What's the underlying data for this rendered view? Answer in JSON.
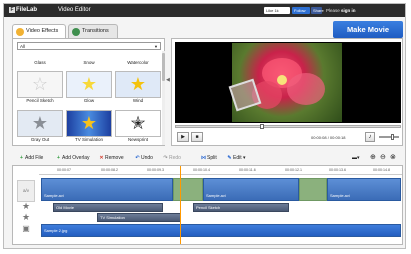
{
  "header": {
    "logo": "FileLab",
    "app_title": "Video Editor",
    "social": [
      "Like 1k",
      "Follow",
      "Share"
    ],
    "login_prefix": "Please",
    "login_link": "sign in"
  },
  "tabs": [
    {
      "label": "Video Effects"
    },
    {
      "label": "Transitions"
    }
  ],
  "make_movie_label": "Make Movie",
  "effects": {
    "filter_selected": "All",
    "items": [
      {
        "label": "Glass"
      },
      {
        "label": "Snow"
      },
      {
        "label": "Watercolor"
      },
      {
        "label": "Pencil Sketch"
      },
      {
        "label": "Glow"
      },
      {
        "label": "Wind"
      },
      {
        "label": "Gray Out"
      },
      {
        "label": "TV Simulation"
      },
      {
        "label": "Newsprint"
      }
    ]
  },
  "player": {
    "time_current": "00:00:08",
    "time_total": "00:00:18",
    "progress": 0.38,
    "volume": 0.7
  },
  "toolbar": {
    "add_file": "Add File",
    "add_overlay": "Add Overlay",
    "remove": "Remove",
    "undo": "Undo",
    "redo": "Redo",
    "split": "Split",
    "edit": "Edit"
  },
  "timeline": {
    "ruler": [
      "00:00:07",
      "00:00:08.2",
      "00:00:09.3",
      "00:00:10.4",
      "00:00:11.6",
      "00:00:12.1",
      "00:00:13.6",
      "00:00:14.8"
    ],
    "track_label": "a/v",
    "clips": {
      "main_a": "Sample.avi",
      "main_b": "Sample.avi",
      "main_c": "Sample.avi",
      "effect_1": "Old Movie",
      "effect_2": "Pencil Sketch",
      "effect_3": "TV Simulation",
      "image": "Sample 2.jpg"
    }
  }
}
